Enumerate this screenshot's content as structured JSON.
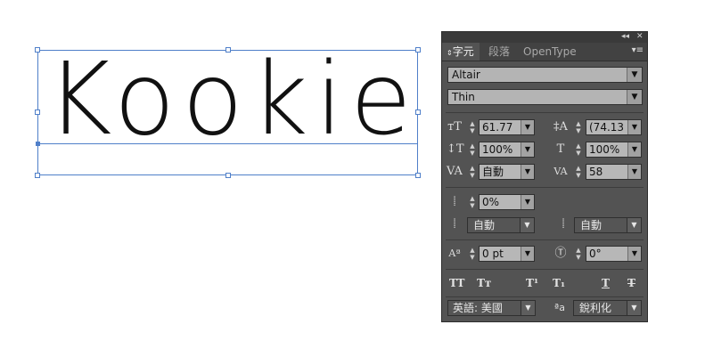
{
  "canvas": {
    "text": "Kookie"
  },
  "panel": {
    "collapse_icon": "collapse-icon",
    "close_icon": "close-icon",
    "tabs": [
      {
        "label": "字元",
        "active": true
      },
      {
        "label": "段落",
        "active": false
      },
      {
        "label": "OpenType",
        "active": false
      }
    ],
    "font_family": "Altair",
    "font_style": "Thin",
    "font_size": "61.77",
    "leading": "(74.13",
    "vertical_scale": "100%",
    "horizontal_scale": "100%",
    "kerning": "自動",
    "tracking": "58",
    "tsume": "0%",
    "aki_left": "自動",
    "aki_right": "自動",
    "baseline_shift": "0 pt",
    "rotation": "0°",
    "type_buttons": [
      "TT",
      "Tт",
      "T¹",
      "T₁",
      "T",
      "T"
    ],
    "language": "英語: 美國",
    "antialias_icon_label": "ªa",
    "antialias": "銳利化"
  }
}
